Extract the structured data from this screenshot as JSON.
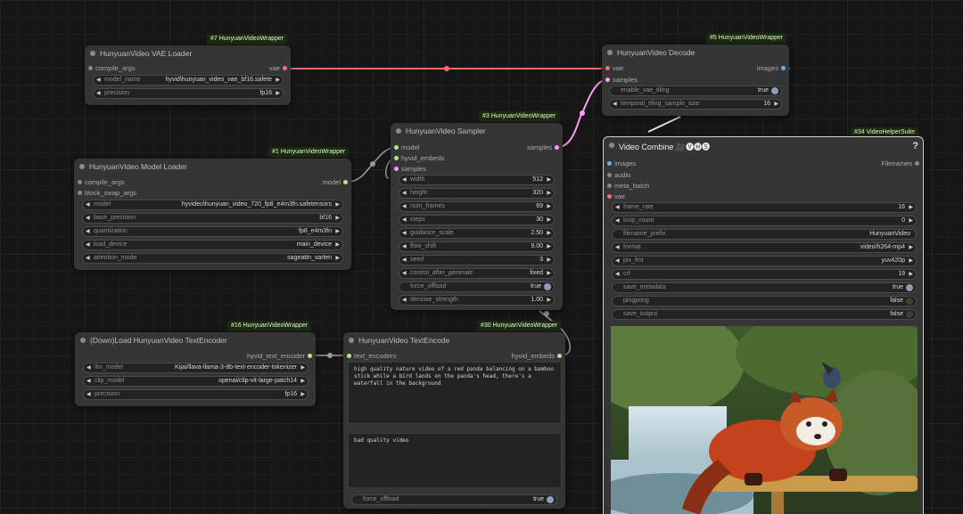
{
  "nodes": {
    "vae_loader": {
      "badge": "#7 HunyuanVideoWrapper",
      "title": "HunyuanVideo VAE Loader",
      "inputs": [
        "compile_args"
      ],
      "outputs": [
        "vae"
      ],
      "widgets": [
        {
          "label": "model_name",
          "value": "hyvid\\hunyuan_video_vae_bf16.safete"
        },
        {
          "label": "precision",
          "value": "fp16"
        }
      ]
    },
    "model_loader": {
      "badge": "#1 HunyuanVideoWrapper",
      "title": "HunyuanVideo Model Loader",
      "inputs": [
        "compile_args",
        "block_swap_args"
      ],
      "outputs": [
        "model"
      ],
      "widgets": [
        {
          "label": "model",
          "value": "hyvideo\\hunyuan_video_720_fp8_e4m3fn.safetensors"
        },
        {
          "label": "base_precision",
          "value": "bf16"
        },
        {
          "label": "quantization",
          "value": "fp8_e4m3fn"
        },
        {
          "label": "load_device",
          "value": "main_device"
        },
        {
          "label": "attention_mode",
          "value": "sageattn_varlen"
        }
      ]
    },
    "sampler": {
      "badge": "#3 HunyuanVideoWrapper",
      "title": "HunyuanVideo Sampler",
      "inputs": [
        "model",
        "hyvid_embeds",
        "samples"
      ],
      "outputs": [
        "samples"
      ],
      "widgets": [
        {
          "label": "width",
          "value": "512"
        },
        {
          "label": "height",
          "value": "320"
        },
        {
          "label": "num_frames",
          "value": "69"
        },
        {
          "label": "steps",
          "value": "30"
        },
        {
          "label": "guidance_scale",
          "value": "2.50"
        },
        {
          "label": "flow_shift",
          "value": "9.00"
        },
        {
          "label": "seed",
          "value": "3"
        },
        {
          "label": "control_after_generate",
          "value": "fixed"
        },
        {
          "label": "force_offload",
          "value": "true"
        },
        {
          "label": "denoise_strength",
          "value": "1.00"
        }
      ]
    },
    "decode": {
      "badge": "#5 HunyuanVideoWrapper",
      "title": "HunyuanVideo Decode",
      "inputs": [
        "vae",
        "samples"
      ],
      "outputs": [
        "images"
      ],
      "widgets": [
        {
          "label": "enable_vae_tiling",
          "value": "true"
        },
        {
          "label": "temporal_tiling_sample_size",
          "value": "16"
        }
      ]
    },
    "video_combine": {
      "badge": "#34 VideoHelperSuite",
      "title": "Video Combine 🎥🅥🅗🅢",
      "help": "?",
      "inputs": [
        "images",
        "audio",
        "meta_batch",
        "vae"
      ],
      "outputs": [
        "Filenames"
      ],
      "widgets": [
        {
          "label": "frame_rate",
          "value": "16"
        },
        {
          "label": "loop_count",
          "value": "0"
        },
        {
          "label": "filename_prefix",
          "value": "HunyuanVideo"
        },
        {
          "label": "format",
          "value": "video/h264-mp4"
        },
        {
          "label": "pix_fmt",
          "value": "yuv420p"
        },
        {
          "label": "crf",
          "value": "19"
        },
        {
          "label": "save_metadata",
          "value": "true"
        },
        {
          "label": "pingpong",
          "value": "false"
        },
        {
          "label": "save_output",
          "value": "false"
        }
      ]
    },
    "text_encoder_loader": {
      "badge": "#16 HunyuanVideoWrapper",
      "title": "(Down)Load HunyuanVideo TextEncoder",
      "outputs": [
        "hyvid_text_encoder"
      ],
      "widgets": [
        {
          "label": "llm_model",
          "value": "Kijai/llava-llama-3-8b-text-encoder-tokenizer"
        },
        {
          "label": "clip_model",
          "value": "openai/clip-vit-large-patch14"
        },
        {
          "label": "precision",
          "value": "fp16"
        }
      ]
    },
    "text_encode": {
      "badge": "#30 HunyuanVideoWrapper",
      "title": "HunyuanVideo TextEncode",
      "inputs": [
        "text_encoders"
      ],
      "outputs": [
        "hyvid_embeds"
      ],
      "prompt": "high quality nature video of a red panda balancing on a bamboo stick while a bird lands on the panda's head, there's a waterfall in the background",
      "negative_prompt": "bad quality video",
      "force_offload_label": "force_offload",
      "force_offload_value": "true"
    }
  },
  "colors": {
    "vae_wire": "#ff6e6e",
    "latent_wire": "#ff9cf9",
    "grey_wire": "#9a9a9a",
    "image_port": "#64b5f6"
  }
}
